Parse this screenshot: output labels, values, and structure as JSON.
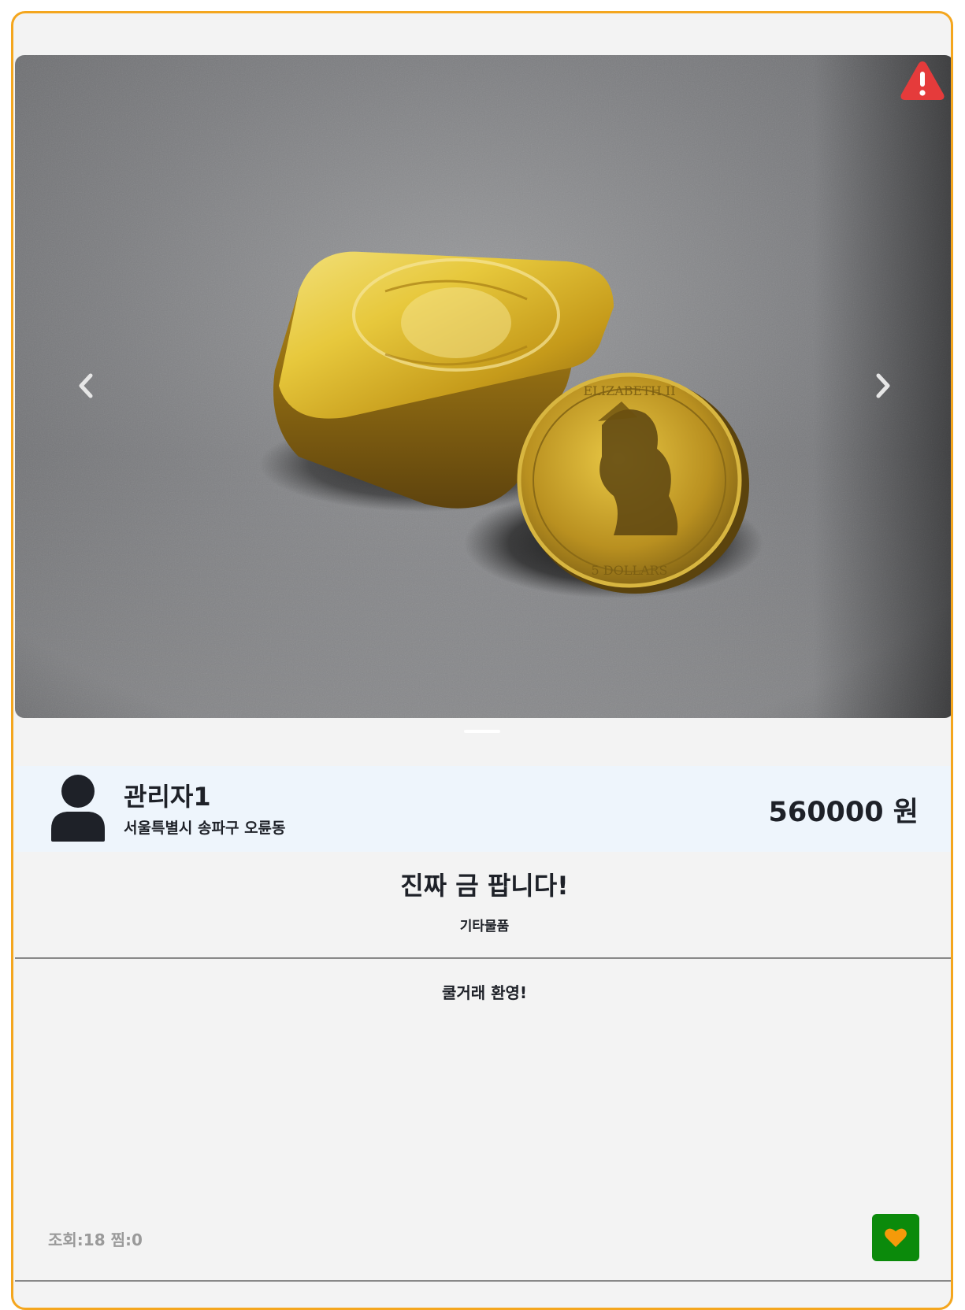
{
  "product": {
    "image_alt": "gold bar and gold coin",
    "seller_name": "관리자1",
    "seller_location": "서울특별시 송파구 오륜동",
    "price": "560000 원",
    "title": "진짜 금 팝니다!",
    "category": "기타물품",
    "description": "쿨거래 환영!",
    "stats": "조회:18 찜:0"
  },
  "carousel": {
    "slide_count": 1,
    "active_slide": 1
  },
  "colors": {
    "card_border": "#f4a61e",
    "seller_bar": "#eef5fc",
    "like_button": "#0b8a0b",
    "heart": "#f59a0a",
    "report_icon": "#e53b3b"
  },
  "icons": {
    "report": "warning-triangle-icon",
    "prev": "chevron-left-icon",
    "next": "chevron-right-icon",
    "avatar": "user-icon",
    "like": "heart-icon"
  }
}
